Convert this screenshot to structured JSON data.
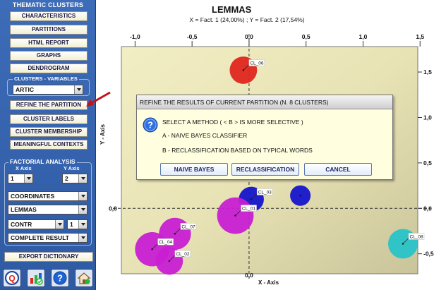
{
  "sidebar": {
    "title": "THEMATIC CLUSTERS",
    "buttons": [
      "CHARACTERISTICS",
      "PARTITIONS",
      "HTML REPORT",
      "GRAPHS",
      "DENDROGRAM"
    ],
    "clusters_variables_label": "CLUSTERS - VARIABLES",
    "clusters_variables_value": "ARTIC",
    "buttons2": [
      "REFINE THE PARTITION",
      "CLUSTER LABELS",
      "CLUSTER MEMBERSHIP",
      "MEANINGFUL CONTEXTS"
    ],
    "factorial_title": "FACTORIAL ANALYSIS",
    "x_axis_label": "X Axis",
    "x_axis_value": "1",
    "y_axis_label": "Y Axis",
    "y_axis_value": "2",
    "coordinates_value": "COORDINATES",
    "lemmas_value": "LEMMAS",
    "contr_value": "CONTR",
    "contr_num_value": "1",
    "complete_result_value": "COMPLETE RESULT",
    "export_label": "EXPORT DICTIONARY",
    "icons": [
      "q-logo-icon",
      "chart-export-icon",
      "help-icon",
      "home-icon"
    ]
  },
  "chart_data": {
    "type": "scatter",
    "title": "LEMMAS",
    "subtitle": "X = Fact. 1 (24,00%) ; Y = Fact. 2 (17,54%)",
    "xlabel": "X - Axis",
    "ylabel": "Y - Axis",
    "xlim": [
      -1.12,
      1.48
    ],
    "ylim": [
      -0.72,
      1.78
    ],
    "xticks": [
      -1.0,
      -0.5,
      0.0,
      0.5,
      1.0,
      1.5
    ],
    "xtick_labels": [
      "-1,0",
      "-0,5",
      "0,0",
      "0,5",
      "1,0",
      "1,5"
    ],
    "yticks": [
      -0.5,
      0.0,
      0.5,
      1.0,
      1.5
    ],
    "ytick_labels": [
      "-0,5",
      "0,0",
      "0,5",
      "1,0",
      "1,5"
    ],
    "grid": false,
    "points": [
      {
        "label": "CL_06",
        "x": -0.05,
        "y": 1.52,
        "r": 0.12,
        "color": "#e0261d"
      },
      {
        "label": "CL_03",
        "x": 0.02,
        "y": 0.1,
        "r": 0.11,
        "color": "#1515cc"
      },
      {
        "label": "",
        "x": 0.45,
        "y": 0.14,
        "r": 0.09,
        "color": "#1515cc"
      },
      {
        "label": "CL_01",
        "x": -0.12,
        "y": -0.08,
        "r": 0.16,
        "color": "#c81ed2"
      },
      {
        "label": "CL_07",
        "x": -0.65,
        "y": -0.28,
        "r": 0.14,
        "color": "#c81ed2"
      },
      {
        "label": "CL_04",
        "x": -0.85,
        "y": -0.45,
        "r": 0.15,
        "color": "#c81ed2"
      },
      {
        "label": "CL_02",
        "x": -0.7,
        "y": -0.58,
        "r": 0.12,
        "color": "#c81ed2"
      },
      {
        "label": "CL_08",
        "x": 1.35,
        "y": -0.39,
        "r": 0.13,
        "color": "#28c3c8"
      }
    ]
  },
  "dialog": {
    "title": "REFINE THE RESULTS OF CURRENT PARTITION (N.  8 CLUSTERS)",
    "line1": "SELECT A METHOD  ( < B > IS MORE SELECTIVE )",
    "line2": "A - NAIVE BAYES CLASSIFIER",
    "line3": "B - RECLASSIFICATION BASED ON TYPICAL WORDS",
    "btn_naive": "NAIVE BAYES",
    "btn_reclass": "RECLASSIFICATION",
    "btn_cancel": "CANCEL"
  },
  "colors": {
    "panel": "#3563ae",
    "button_bg": "#f3efd0",
    "dialog_bg": "#ffffe0",
    "arrow": "#c0141a"
  }
}
